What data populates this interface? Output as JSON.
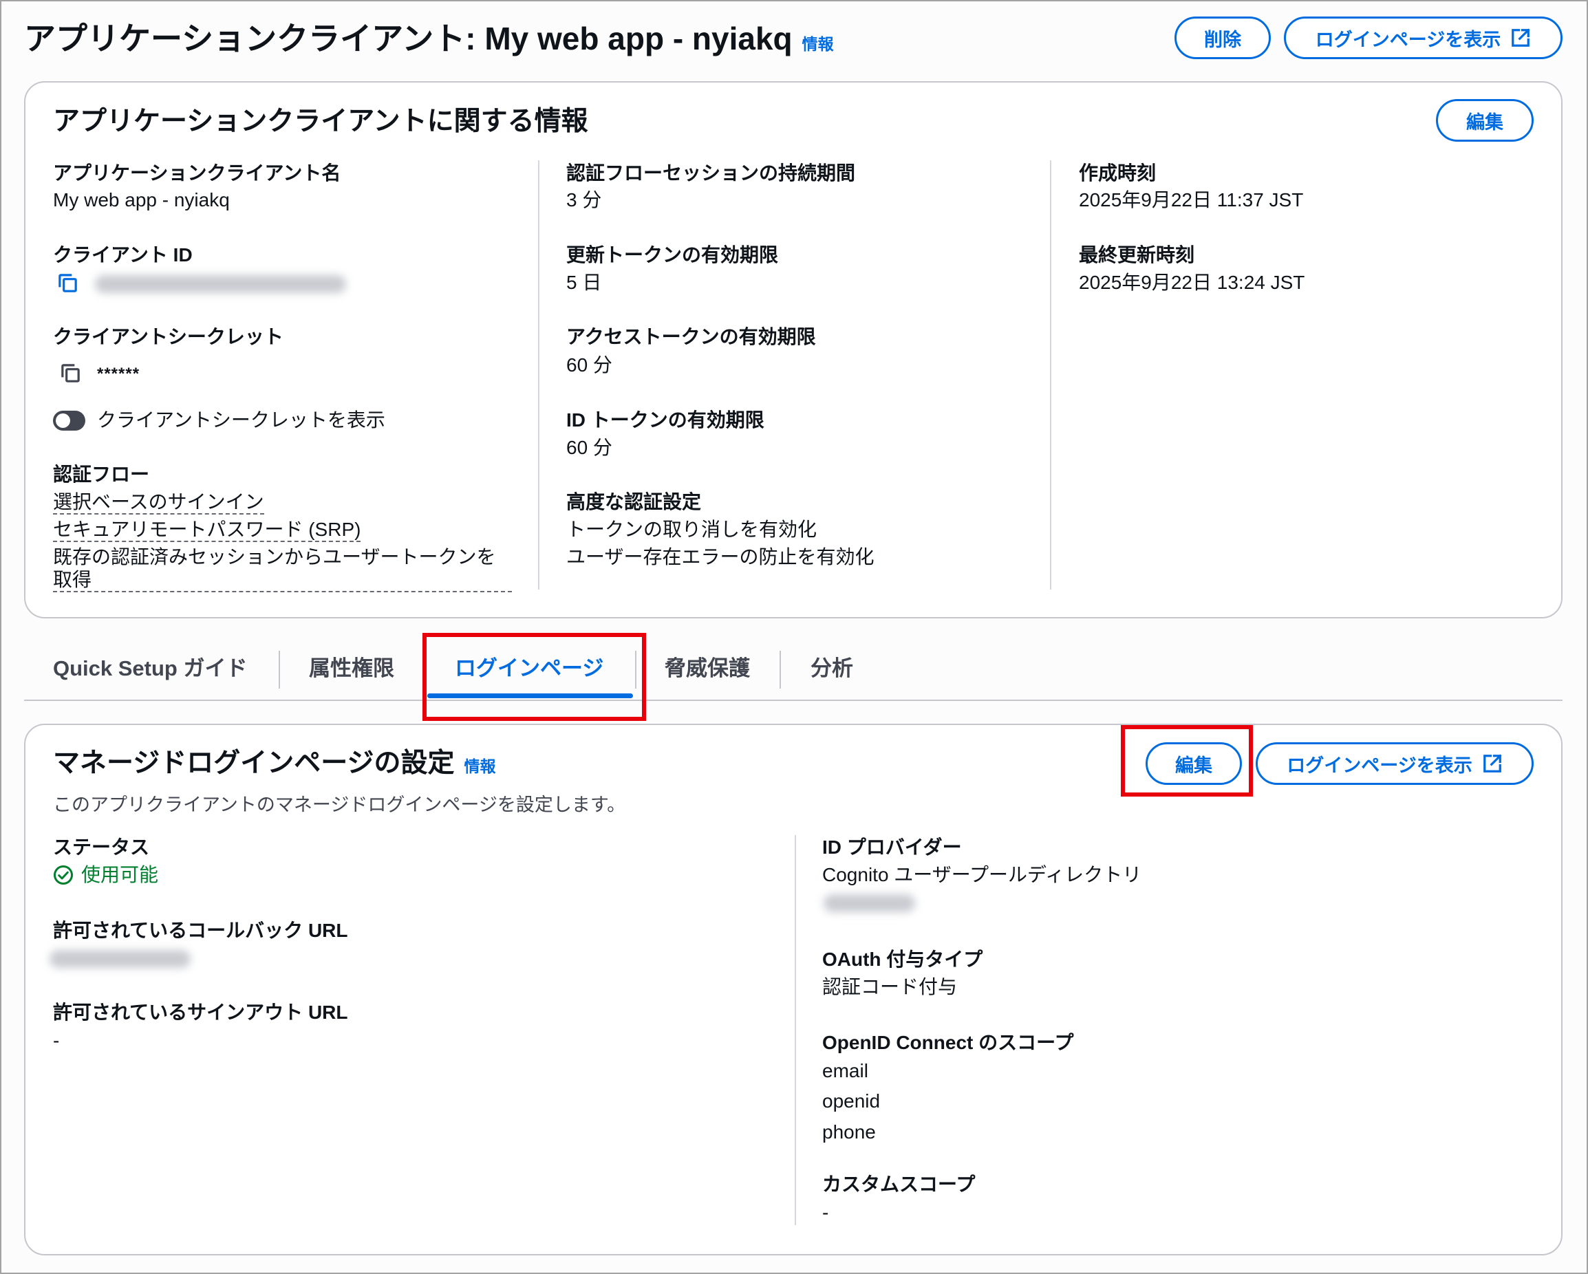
{
  "header": {
    "title": "アプリケーションクライアント: My web app - nyiakq",
    "info_link": "情報",
    "delete_button": "削除",
    "view_login_page_button": "ログインページを表示"
  },
  "app_client_info": {
    "heading": "アプリケーションクライアントに関する情報",
    "edit_button": "編集",
    "client_name": {
      "label": "アプリケーションクライアント名",
      "value": "My web app - nyiakq"
    },
    "client_id": {
      "label": "クライアント ID"
    },
    "client_secret": {
      "label": "クライアントシークレット",
      "value": "******"
    },
    "show_secret_toggle": {
      "label": "クライアントシークレットを表示",
      "checked": false
    },
    "auth_flows": {
      "label": "認証フロー",
      "items": [
        "選択ベースのサインイン",
        "セキュアリモートパスワード (SRP)",
        "既存の認証済みセッションからユーザートークンを取得"
      ]
    },
    "auth_flow_session_duration": {
      "label": "認証フローセッションの持続期間",
      "value": "3 分"
    },
    "refresh_token_validity": {
      "label": "更新トークンの有効期限",
      "value": "5 日"
    },
    "access_token_validity": {
      "label": "アクセストークンの有効期限",
      "value": "60 分"
    },
    "id_token_validity": {
      "label": "ID トークンの有効期限",
      "value": "60 分"
    },
    "advanced_auth_settings": {
      "label": "高度な認証設定",
      "values": [
        "トークンの取り消しを有効化",
        "ユーザー存在エラーの防止を有効化"
      ]
    },
    "created_time": {
      "label": "作成時刻",
      "value": "2025年9月22日 11:37 JST"
    },
    "last_updated_time": {
      "label": "最終更新時刻",
      "value": "2025年9月22日 13:24 JST"
    }
  },
  "tabs": [
    {
      "label": "Quick Setup ガイド",
      "active": false
    },
    {
      "label": "属性権限",
      "active": false
    },
    {
      "label": "ログインページ",
      "active": true
    },
    {
      "label": "脅威保護",
      "active": false
    },
    {
      "label": "分析",
      "active": false
    }
  ],
  "managed_login": {
    "heading": "マネージドログインページの設定",
    "info_link": "情報",
    "description": "このアプリクライアントのマネージドログインページを設定します。",
    "edit_button": "編集",
    "view_login_page_button": "ログインページを表示",
    "status": {
      "label": "ステータス",
      "value": "使用可能"
    },
    "callback_urls": {
      "label": "許可されているコールバック URL"
    },
    "signout_urls": {
      "label": "許可されているサインアウト URL",
      "value": "-"
    },
    "identity_providers": {
      "label": "ID プロバイダー",
      "value": "Cognito ユーザープールディレクトリ"
    },
    "oauth_grant_types": {
      "label": "OAuth 付与タイプ",
      "value": "認証コード付与"
    },
    "openid_scopes": {
      "label": "OpenID Connect のスコープ",
      "values": [
        "email",
        "openid",
        "phone"
      ]
    },
    "custom_scopes": {
      "label": "カスタムスコープ",
      "value": "-"
    }
  },
  "icons": {
    "copy": "copy-icon",
    "external_link": "external-link-icon",
    "status_positive": "check-circle-icon",
    "toggle": "toggle-switch"
  },
  "colors": {
    "primary": "#006ce0",
    "text": "#0f141a",
    "muted": "#424650",
    "border": "#c6c6cd",
    "success": "#00802f",
    "highlight": "#e8000b",
    "toggle": "#424650"
  }
}
